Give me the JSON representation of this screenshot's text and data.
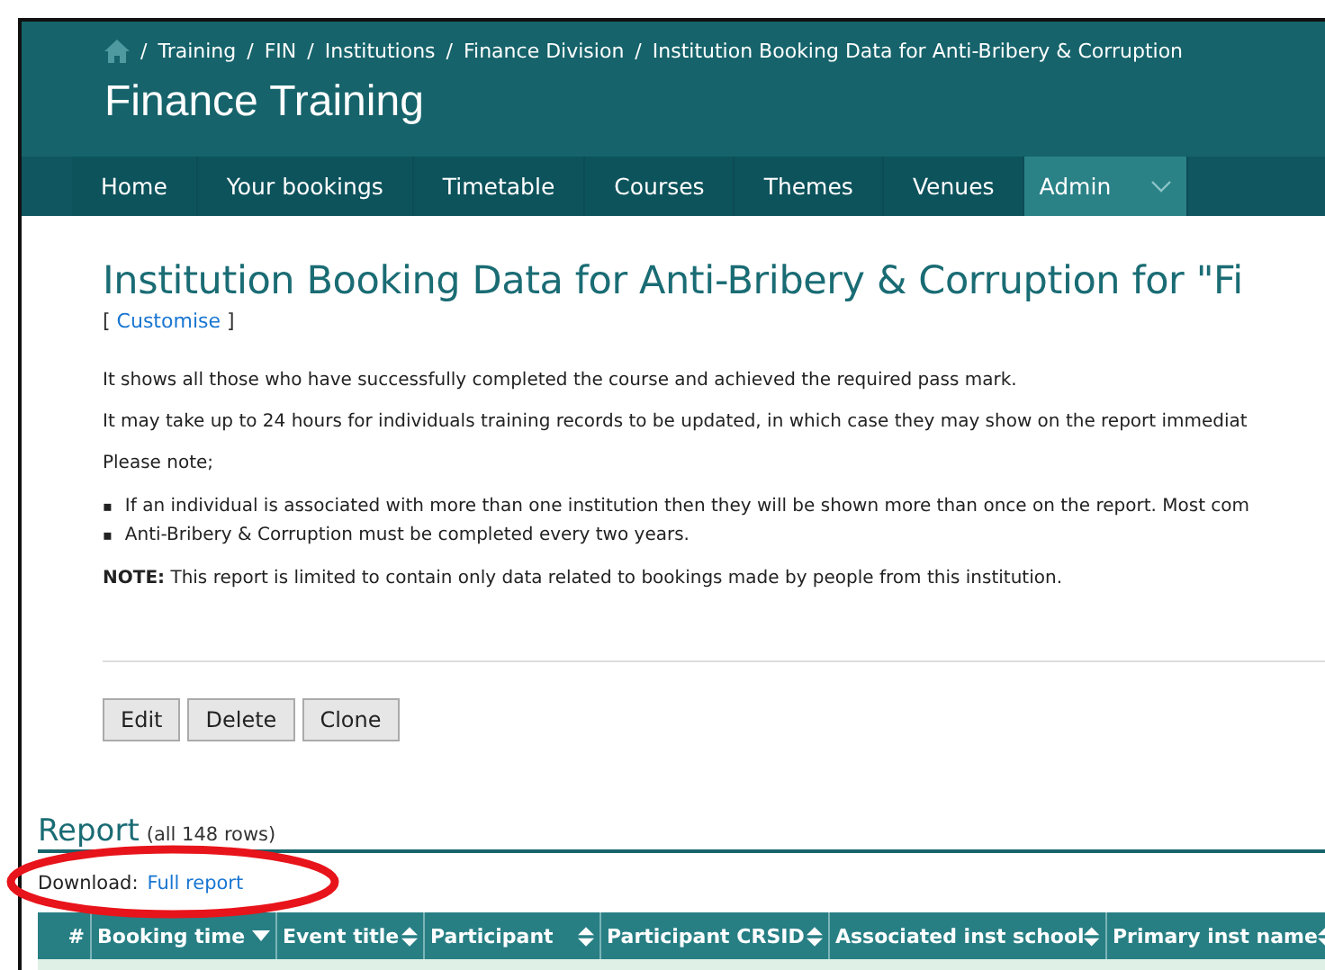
{
  "breadcrumb": [
    {
      "sep": "/",
      "label": "Training"
    },
    {
      "sep": "/",
      "label": "FIN"
    },
    {
      "sep": "/",
      "label": "Institutions"
    },
    {
      "sep": "/",
      "label": "Finance Division"
    },
    {
      "sep": "/",
      "label": "Institution Booking Data for Anti-Bribery & Corruption"
    }
  ],
  "site_title": "Finance Training",
  "nav": [
    {
      "label": "Home",
      "selected": false
    },
    {
      "label": "Your bookings",
      "selected": false
    },
    {
      "label": "Timetable",
      "selected": false
    },
    {
      "label": "Courses",
      "selected": false
    },
    {
      "label": "Themes",
      "selected": false
    },
    {
      "label": "Venues",
      "selected": false
    },
    {
      "label": "Admin",
      "selected": true
    }
  ],
  "page_title": "Institution Booking Data for Anti-Bribery & Corruption for \"Fi",
  "customise": {
    "open": "[",
    "label": "Customise",
    "close": "]"
  },
  "paragraphs": [
    "It shows all those who have successfully completed the course and achieved the required pass mark.",
    "It may take up to 24 hours for individuals training records to be updated, in which case they may show on the report immediat",
    "Please note;"
  ],
  "bullets": [
    {
      "marker": "▪",
      "text": "If an individual is associated with more than one institution then they will be shown more than once on the report. Most com"
    },
    {
      "marker": "▪",
      "text": "Anti-Bribery & Corruption must be completed every two years."
    }
  ],
  "note": "**NOTE:** This report is limited to contain only data related to bookings made by people from this institution.",
  "buttons": [
    "Edit",
    "Delete",
    "Clone"
  ],
  "report": {
    "title": "Report",
    "count": "(all 148 rows)",
    "download_label": "Download:",
    "download_link": "Full report",
    "columns": [
      {
        "label": "#",
        "kind": "plain"
      },
      {
        "label": "Booking time",
        "kind": "sorted"
      },
      {
        "label": "Event title",
        "kind": "sortable"
      },
      {
        "label": "Participant",
        "kind": "sortable"
      },
      {
        "label": "Participant CRSID",
        "kind": "sortable"
      },
      {
        "label": "Associated inst school",
        "kind": "sortable"
      },
      {
        "label": "Primary inst name",
        "kind": "sortable"
      }
    ]
  }
}
